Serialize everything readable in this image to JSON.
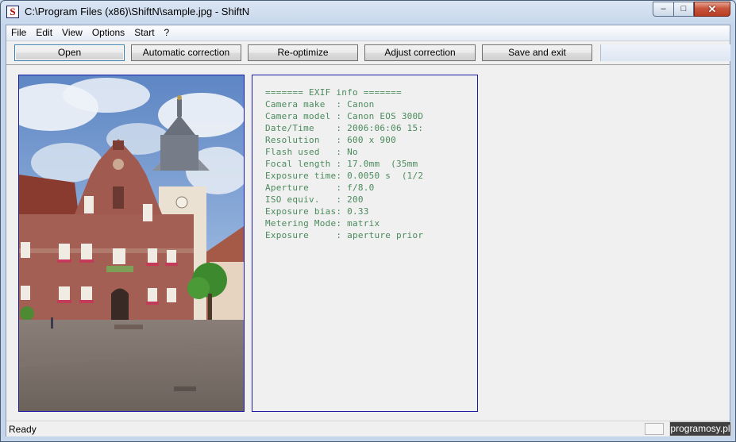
{
  "window": {
    "title": "C:\\Program Files (x86)\\ShiftN\\sample.jpg - ShiftN",
    "app_icon_letter": "S",
    "controls": {
      "minimize": "–",
      "maximize": "□",
      "close": "✕"
    }
  },
  "menu": {
    "items": [
      "File",
      "Edit",
      "View",
      "Options",
      "Start",
      "?"
    ]
  },
  "toolbar": {
    "open": "Open",
    "automatic_correction": "Automatic correction",
    "reoptimize": "Re-optimize",
    "adjust_correction": "Adjust correction",
    "save_and_exit": "Save and exit"
  },
  "exif": {
    "lines": [
      "======= EXIF info =======",
      "Camera make  : Canon",
      "Camera model : Canon EOS 300D",
      "Date/Time    : 2006:06:06 15:",
      "Resolution   : 600 x 900",
      "Flash used   : No",
      "Focal length : 17.0mm  (35mm",
      "Exposure time: 0.0050 s  (1/2",
      "Aperture     : f/8.0",
      "ISO equiv.   : 200",
      "Exposure bias: 0.33",
      "Metering Mode: matrix",
      "Exposure     : aperture prior"
    ]
  },
  "status": {
    "text": "Ready",
    "badge": "programosy.pl"
  },
  "colors": {
    "exif_text": "#4a8a5c",
    "panel_border": "#1a1aa8"
  }
}
